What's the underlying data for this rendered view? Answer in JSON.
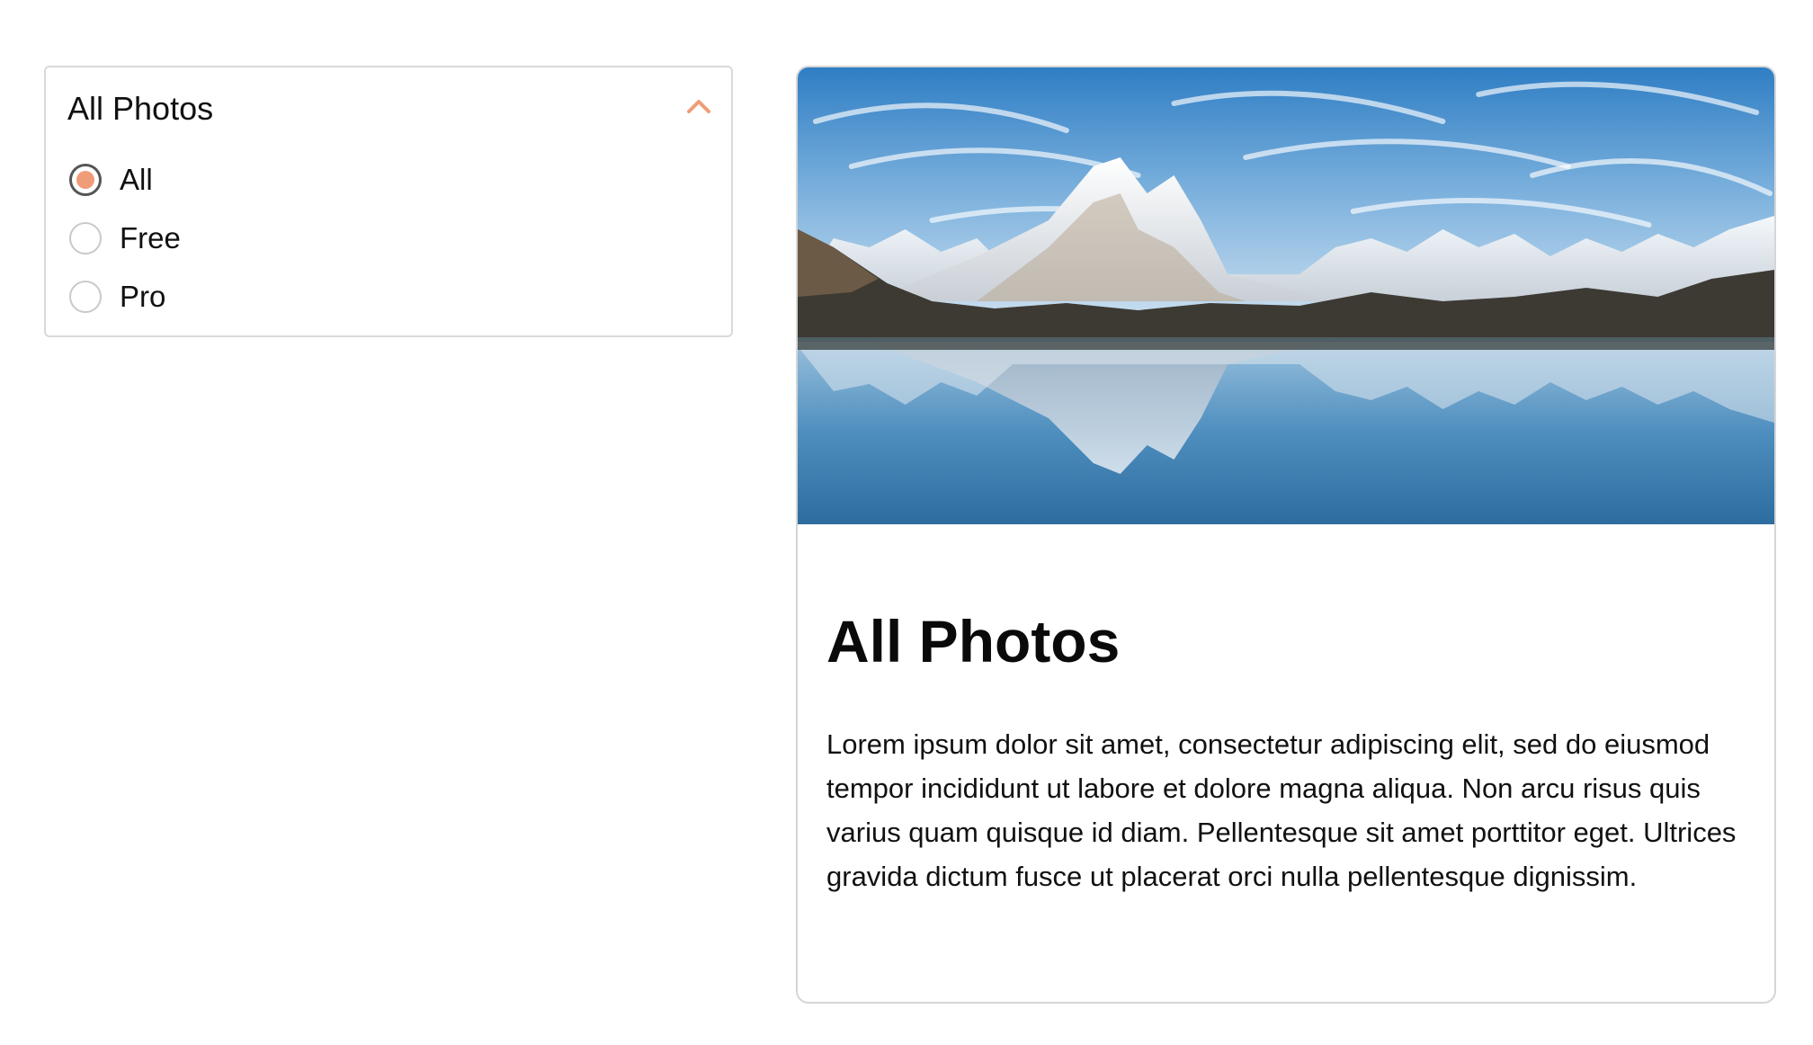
{
  "filter": {
    "title": "All Photos",
    "chevron_icon": "chevron-up-icon",
    "accent_color": "#f09c78",
    "options": [
      {
        "label": "All",
        "checked": true
      },
      {
        "label": "Free",
        "checked": false
      },
      {
        "label": "Pro",
        "checked": false
      }
    ]
  },
  "card": {
    "image_subject": "mountain-lake-reflection",
    "title": "All Photos",
    "body": "Lorem ipsum dolor sit amet, consectetur adipiscing elit, sed do eiusmod tempor incididunt ut labore et dolore magna aliqua. Non arcu risus quis varius quam quisque id diam. Pellentesque sit amet porttitor eget. Ultrices gravida dictum fusce ut placerat orci nulla pellentesque dignissim."
  }
}
